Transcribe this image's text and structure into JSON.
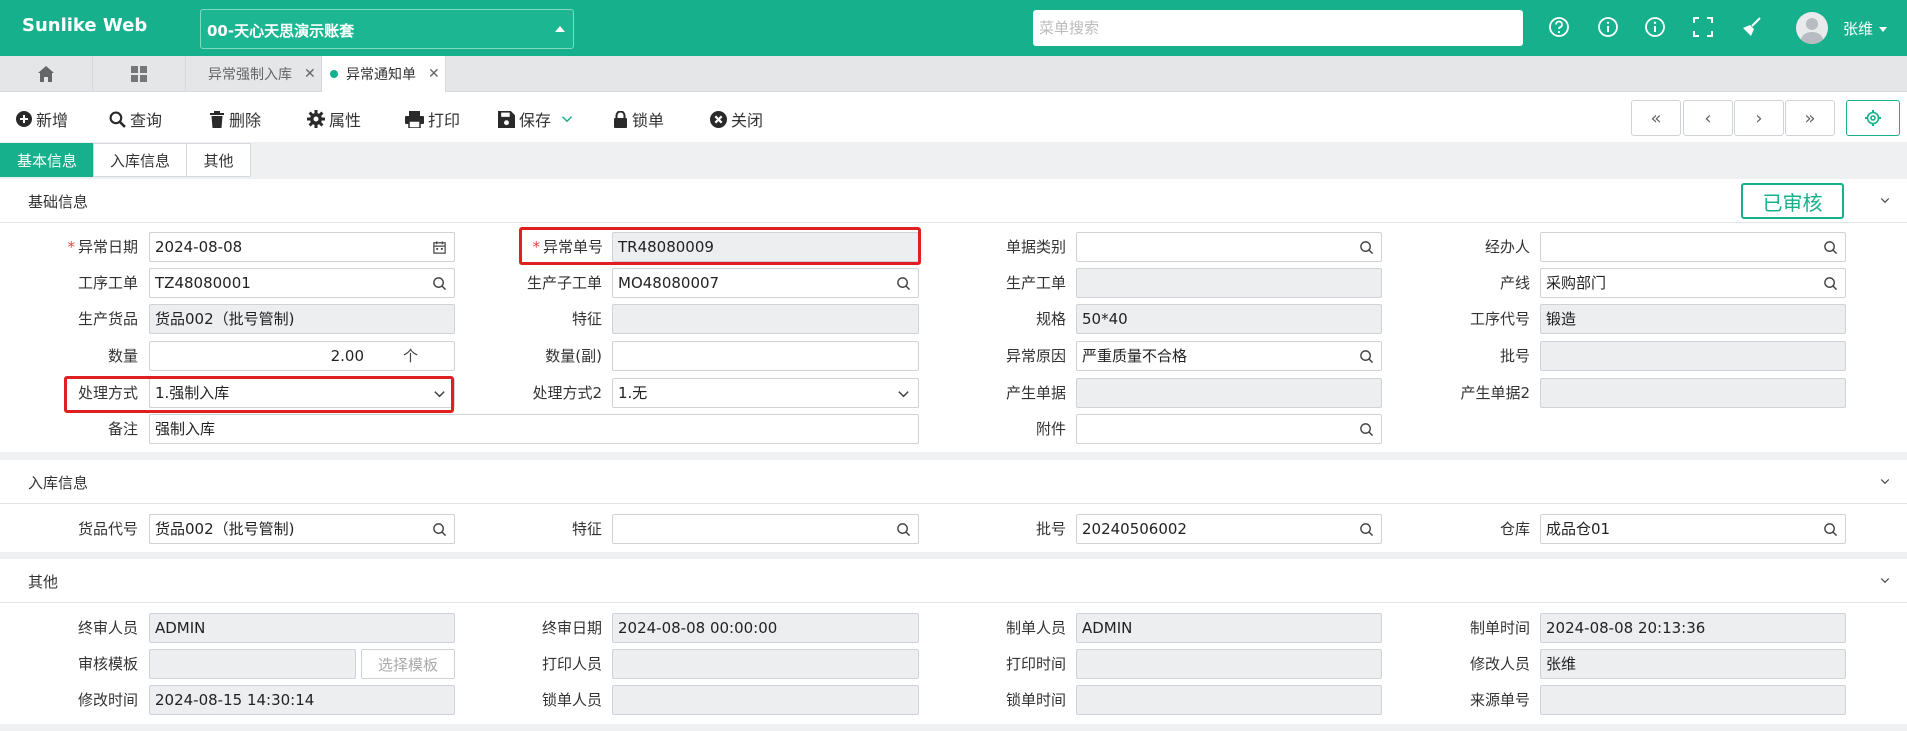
{
  "app": {
    "brand": "Sunlike Web",
    "account": "00-天心天思演示账套",
    "menu_search_placeholder": "菜单搜索",
    "user": "张维"
  },
  "tabs": [
    {
      "label": "异常强制入库",
      "active": false
    },
    {
      "label": "异常通知单",
      "active": true
    }
  ],
  "toolbar": {
    "new": "新增",
    "query": "查询",
    "delete": "删除",
    "properties": "属性",
    "print": "打印",
    "save": "保存",
    "lock": "锁单",
    "close": "关闭"
  },
  "form_tabs": [
    "基本信息",
    "入库信息",
    "其他"
  ],
  "sections": {
    "basic": {
      "title": "基础信息",
      "status": "已审核",
      "fields": {
        "abnormal_date": {
          "label": "异常日期",
          "value": "2024-08-08"
        },
        "abnormal_no": {
          "label": "异常单号",
          "value": "TR48080009"
        },
        "doc_category": {
          "label": "单据类别",
          "value": ""
        },
        "handler": {
          "label": "经办人",
          "value": ""
        },
        "process_order": {
          "label": "工序工单",
          "value": "TZ48080001"
        },
        "production_sub_order": {
          "label": "生产子工单",
          "value": "MO48080007"
        },
        "production_order": {
          "label": "生产工单",
          "value": ""
        },
        "production_line": {
          "label": "产线",
          "value": "采购部门"
        },
        "production_goods": {
          "label": "生产货品",
          "value": "货品002（批号管制)"
        },
        "feature": {
          "label": "特征",
          "value": ""
        },
        "spec": {
          "label": "规格",
          "value": "50*40"
        },
        "process_code": {
          "label": "工序代号",
          "value": "锻造"
        },
        "quantity": {
          "label": "数量",
          "value": "2.00",
          "unit": "个"
        },
        "quantity_sub": {
          "label": "数量(副)",
          "value": ""
        },
        "abnormal_reason": {
          "label": "异常原因",
          "value": "严重质量不合格"
        },
        "batch_no": {
          "label": "批号",
          "value": ""
        },
        "handling_method": {
          "label": "处理方式",
          "value": "1.强制入库"
        },
        "handling_method2": {
          "label": "处理方式2",
          "value": "1.无"
        },
        "generated_doc": {
          "label": "产生单据",
          "value": ""
        },
        "generated_doc2": {
          "label": "产生单据2",
          "value": ""
        },
        "remark": {
          "label": "备注",
          "value": "强制入库"
        },
        "attachment": {
          "label": "附件",
          "value": ""
        }
      }
    },
    "warehousing": {
      "title": "入库信息",
      "fields": {
        "goods_code": {
          "label": "货品代号",
          "value": "货品002（批号管制)"
        },
        "feature": {
          "label": "特征",
          "value": ""
        },
        "batch_no": {
          "label": "批号",
          "value": "20240506002"
        },
        "warehouse": {
          "label": "仓库",
          "value": "成品仓01"
        }
      }
    },
    "other": {
      "title": "其他",
      "select_template": "选择模板",
      "fields": {
        "final_auditor": {
          "label": "终审人员",
          "value": "ADMIN"
        },
        "final_audit_date": {
          "label": "终审日期",
          "value": "2024-08-08 00:00:00"
        },
        "creator": {
          "label": "制单人员",
          "value": "ADMIN"
        },
        "create_time": {
          "label": "制单时间",
          "value": "2024-08-08 20:13:36"
        },
        "audit_template": {
          "label": "审核模板",
          "value": ""
        },
        "printer": {
          "label": "打印人员",
          "value": ""
        },
        "print_time": {
          "label": "打印时间",
          "value": ""
        },
        "modifier": {
          "label": "修改人员",
          "value": "张维"
        },
        "modify_time": {
          "label": "修改时间",
          "value": "2024-08-15 14:30:14"
        },
        "locker": {
          "label": "锁单人员",
          "value": ""
        },
        "lock_time": {
          "label": "锁单时间",
          "value": ""
        },
        "source_no": {
          "label": "来源单号",
          "value": ""
        }
      }
    }
  }
}
